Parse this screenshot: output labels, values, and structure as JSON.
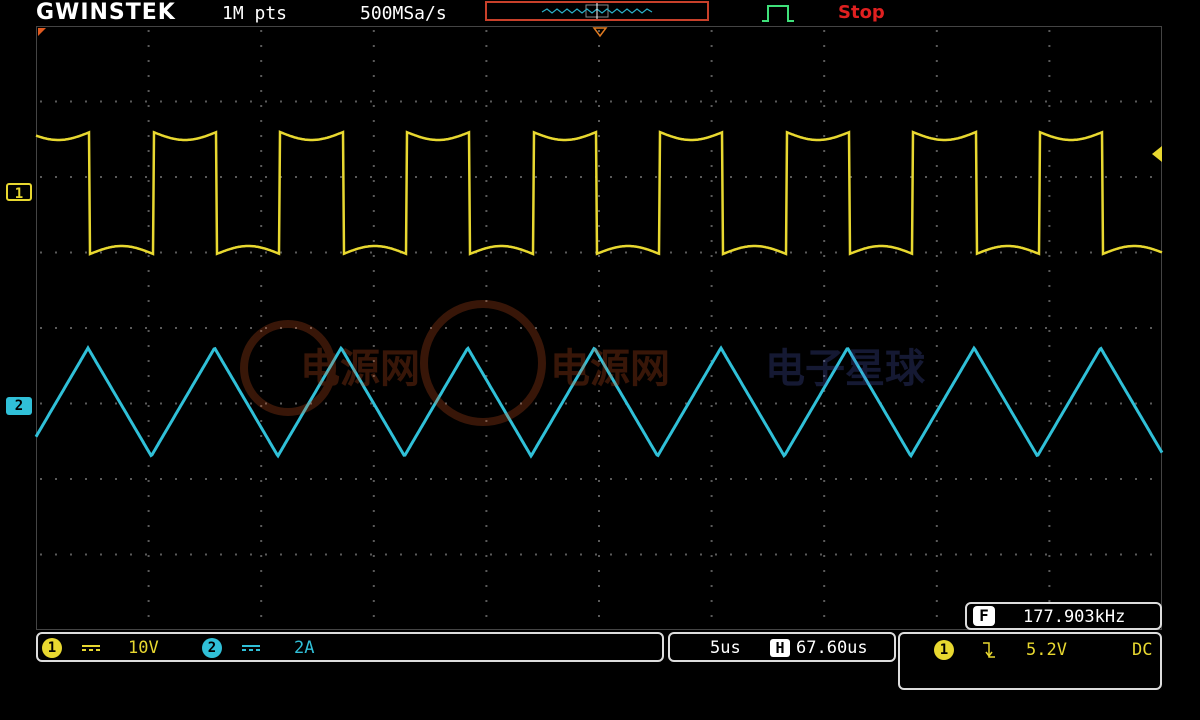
{
  "header": {
    "brand": "GWINSTEK",
    "record_length": "1M pts",
    "sample_rate": "500MSa/s",
    "run_status": "Stop",
    "memory_window": {
      "view_start": 0.45,
      "view_end": 0.55
    }
  },
  "channels": {
    "ch1": {
      "marker": "1",
      "coupling_icon": "dc-coupling-icon",
      "scale": "10V",
      "color": "#e8d830",
      "waveform": "square"
    },
    "ch2": {
      "marker": "2",
      "coupling_icon": "dc-coupling-icon",
      "scale": "2A",
      "color": "#30c0d8",
      "waveform": "triangle"
    }
  },
  "measurement": {
    "label": "F",
    "frequency": "177.903kHz"
  },
  "timebase": {
    "scale": "5us",
    "position_label": "H",
    "position": "67.60us"
  },
  "trigger": {
    "source": "1",
    "slope_icon": "falling-edge-icon",
    "level": "5.2V",
    "coupling": "DC"
  },
  "watermark": {
    "text_1": "电源网",
    "text_2": "电源网",
    "text_3": "电子星球"
  },
  "colors": {
    "run_status": "#e02020",
    "grid": "#5a5a5a",
    "background": "#000000"
  }
}
